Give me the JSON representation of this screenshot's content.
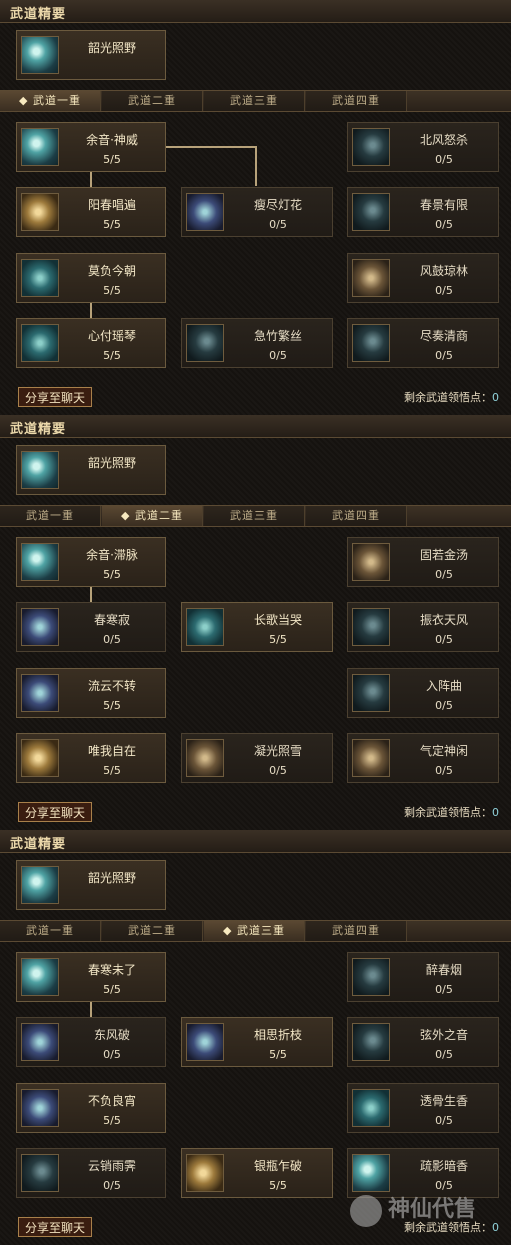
{
  "panels": [
    {
      "section_title": "武道精要",
      "featured": {
        "name": "韶光照野",
        "icon": "skill-icon-cyan"
      },
      "tabs": [
        "武道一重",
        "武道二重",
        "武道三重",
        "武道四重"
      ],
      "active_tab": 0,
      "nodes": [
        {
          "name": "余音·神威",
          "value": "5/5",
          "active": true
        },
        {
          "name": "北风怒杀",
          "value": "0/5",
          "active": false
        },
        {
          "name": "阳春唱遍",
          "value": "5/5",
          "active": true
        },
        {
          "name": "瘦尽灯花",
          "value": "0/5",
          "active": false
        },
        {
          "name": "春景有限",
          "value": "0/5",
          "active": false
        },
        {
          "name": "莫负今朝",
          "value": "5/5",
          "active": true
        },
        {
          "name": "风鼓琼林",
          "value": "0/5",
          "active": false
        },
        {
          "name": "心付瑶琴",
          "value": "5/5",
          "active": true
        },
        {
          "name": "急竹繁丝",
          "value": "0/5",
          "active": false
        },
        {
          "name": "尽奏清商",
          "value": "0/5",
          "active": false
        }
      ],
      "share_label": "分享至聊天",
      "points_label": "剩余武道领悟点：",
      "points_value": "0"
    },
    {
      "section_title": "武道精要",
      "featured": {
        "name": "韶光照野",
        "icon": "skill-icon-cyan"
      },
      "tabs": [
        "武道一重",
        "武道二重",
        "武道三重",
        "武道四重"
      ],
      "active_tab": 1,
      "nodes": [
        {
          "name": "余音·滞脉",
          "value": "5/5",
          "active": true
        },
        {
          "name": "固若金汤",
          "value": "0/5",
          "active": false
        },
        {
          "name": "春寒寂",
          "value": "0/5",
          "active": false
        },
        {
          "name": "长歌当哭",
          "value": "5/5",
          "active": true
        },
        {
          "name": "振衣天风",
          "value": "0/5",
          "active": false
        },
        {
          "name": "流云不转",
          "value": "5/5",
          "active": true
        },
        {
          "name": "入阵曲",
          "value": "0/5",
          "active": false
        },
        {
          "name": "唯我自在",
          "value": "5/5",
          "active": true
        },
        {
          "name": "凝光照雪",
          "value": "0/5",
          "active": false
        },
        {
          "name": "气定神闲",
          "value": "0/5",
          "active": false
        }
      ],
      "share_label": "分享至聊天",
      "points_label": "剩余武道领悟点：",
      "points_value": "0"
    },
    {
      "section_title": "武道精要",
      "featured": {
        "name": "韶光照野",
        "icon": "skill-icon-cyan"
      },
      "tabs": [
        "武道一重",
        "武道二重",
        "武道三重",
        "武道四重"
      ],
      "active_tab": 2,
      "nodes": [
        {
          "name": "春寒未了",
          "value": "5/5",
          "active": true
        },
        {
          "name": "醉春烟",
          "value": "0/5",
          "active": false
        },
        {
          "name": "东风破",
          "value": "0/5",
          "active": false
        },
        {
          "name": "相思折枝",
          "value": "5/5",
          "active": true
        },
        {
          "name": "弦外之音",
          "value": "0/5",
          "active": false
        },
        {
          "name": "不负良宵",
          "value": "5/5",
          "active": true
        },
        {
          "name": "透骨生香",
          "value": "0/5",
          "active": false
        },
        {
          "name": "云销雨霁",
          "value": "0/5",
          "active": false
        },
        {
          "name": "银瓶乍破",
          "value": "5/5",
          "active": true
        },
        {
          "name": "疏影暗香",
          "value": "0/5",
          "active": false
        }
      ],
      "share_label": "分享至聊天",
      "points_label": "剩余武道领悟点：",
      "points_value": "0"
    }
  ],
  "watermark": "神仙代售"
}
